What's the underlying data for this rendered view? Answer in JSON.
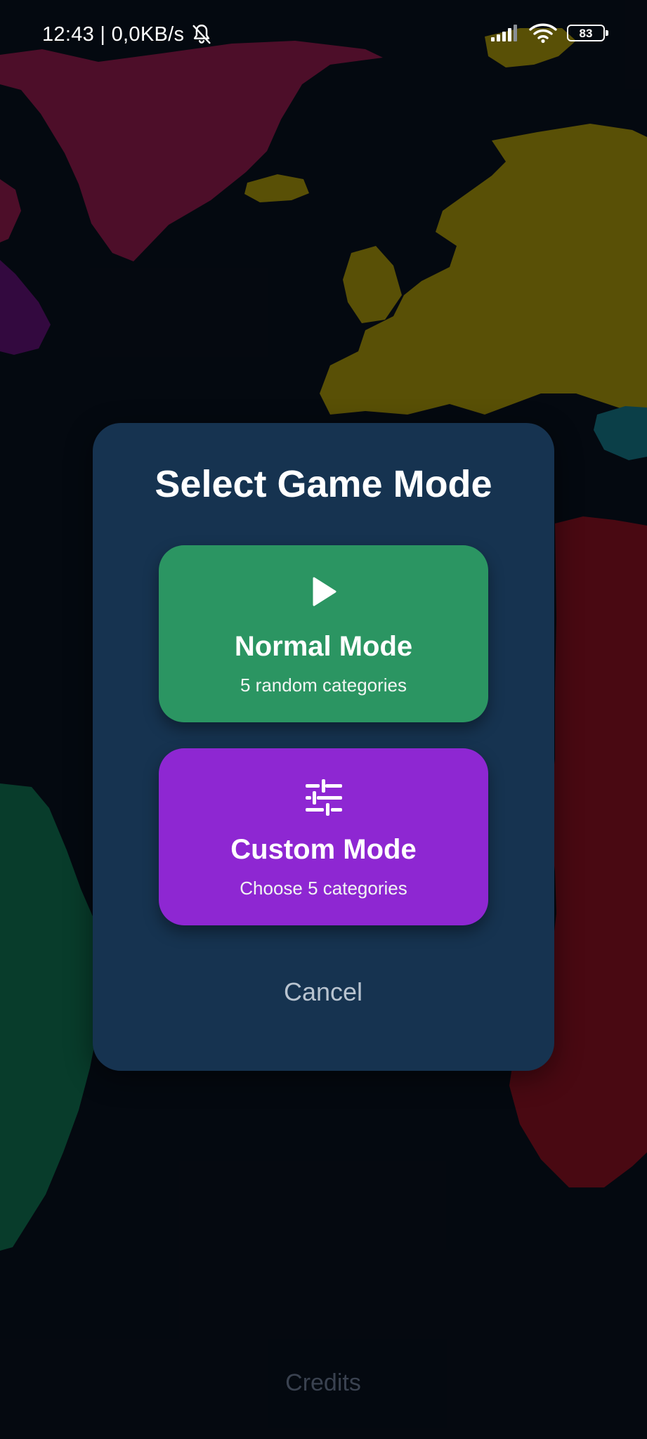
{
  "status_bar": {
    "time_speed": "12:43 | 0,0KB/s",
    "battery_level": "83",
    "icons": [
      "bell-off-icon",
      "signal-icon",
      "wifi-icon",
      "battery-icon"
    ]
  },
  "dialog": {
    "title": "Select Game Mode",
    "normal_mode": {
      "title": "Normal Mode",
      "subtitle": "5 random categories",
      "icon": "play-icon",
      "color": "#2b9562"
    },
    "custom_mode": {
      "title": "Custom Mode",
      "subtitle": "Choose 5 categories",
      "icon": "sliders-icon",
      "color": "#8e27d2"
    },
    "cancel_label": "Cancel",
    "background_color": "#163350"
  },
  "footer": {
    "credits_label": "Credits"
  },
  "colors": {
    "page_background": "#060b14",
    "map_magenta": "#5e1233",
    "map_yellow": "#6d6208",
    "map_purple": "#3f0c4e",
    "map_teal": "#0e4e58",
    "map_red": "#5a0c17",
    "map_green": "#0a4a35"
  }
}
